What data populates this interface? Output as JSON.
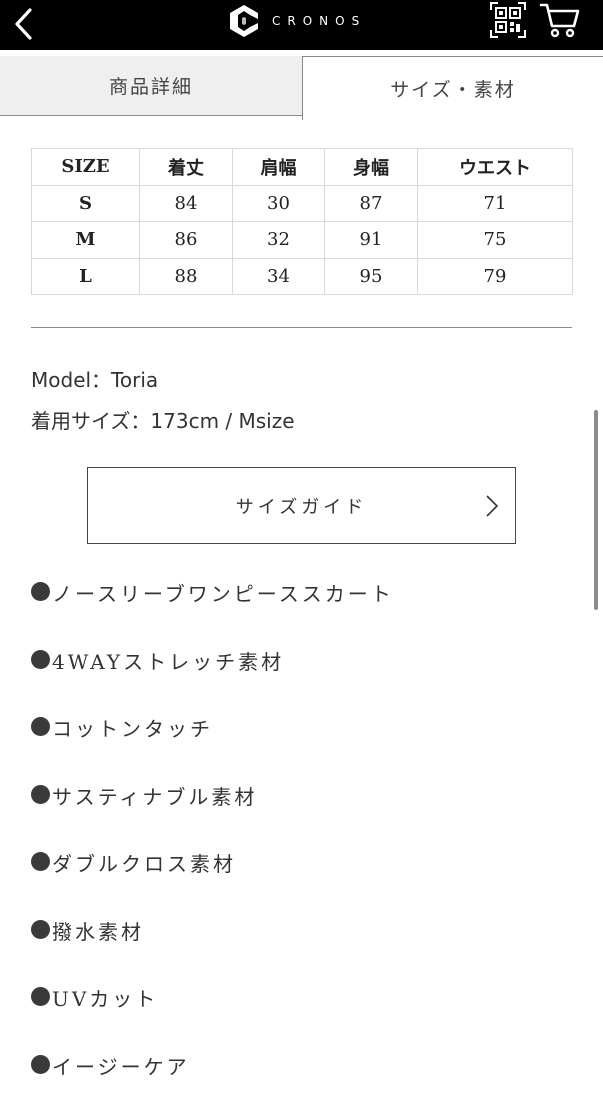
{
  "header": {
    "logo_text": "CRONOS",
    "back_icon": "chevron-left-icon",
    "qr_icon": "qr-code-icon",
    "cart_icon": "cart-icon"
  },
  "tabs": [
    {
      "label": "商品詳細",
      "active": false
    },
    {
      "label": "サイズ・素材",
      "active": true
    }
  ],
  "size_table": {
    "headers": [
      "SIZE",
      "着丈",
      "肩幅",
      "身幅",
      "ウエスト"
    ],
    "rows": [
      [
        "S",
        "84",
        "30",
        "87",
        "71"
      ],
      [
        "M",
        "86",
        "32",
        "91",
        "75"
      ],
      [
        "L",
        "88",
        "34",
        "95",
        "79"
      ]
    ]
  },
  "model": {
    "model_line": "Model：Toria",
    "size_line": "着用サイズ：173cm / Msize"
  },
  "size_guide": {
    "label": "サイズガイド"
  },
  "features": [
    "ノースリーブワンピーススカート",
    "4WAYストレッチ素材",
    "コットンタッチ",
    "サスティナブル素材",
    "ダブルクロス素材",
    "撥水素材",
    "UVカット",
    "イージーケア"
  ],
  "colors": {
    "header_bg": "#000000",
    "inactive_tab_bg": "#efefef",
    "border": "#888888",
    "text": "#333333"
  }
}
